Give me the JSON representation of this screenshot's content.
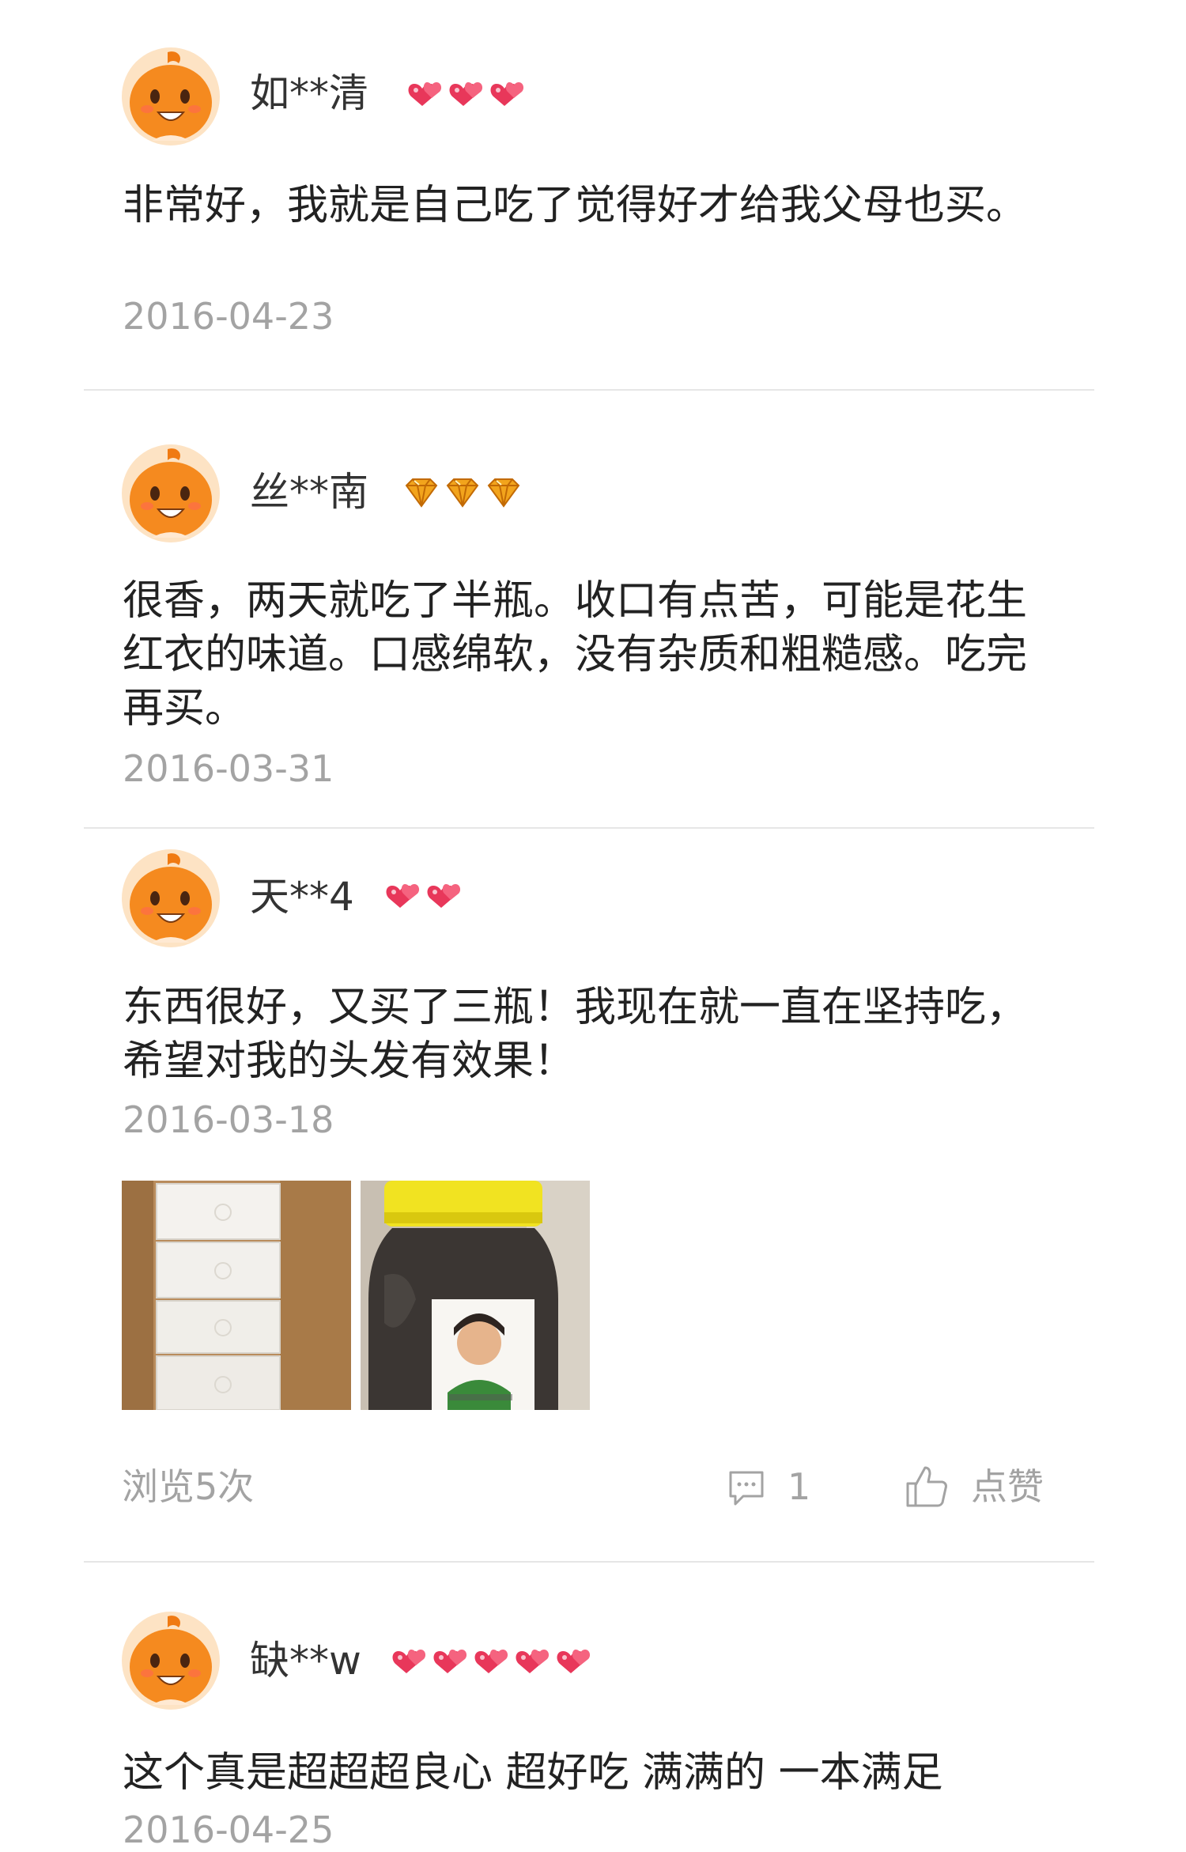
{
  "colors": {
    "text": "#222222",
    "muted": "#a3a3a3",
    "divider": "#e6e6e6",
    "avatar": "#f58a1f",
    "heart": "#e8375a",
    "diamond": "#f2a41c"
  },
  "reviews": [
    {
      "username": "如**清",
      "badge_icon": "heart-badge-icon",
      "badge_count": 3,
      "content": "非常好，我就是自己吃了觉得好才给我父母也买。",
      "date": "2016-04-23"
    },
    {
      "username": "丝**南",
      "badge_icon": "diamond-badge-icon",
      "badge_count": 3,
      "content": "很香，两天就吃了半瓶。收口有点苦，可能是花生红衣的味道。口感绵软，没有杂质和粗糙感。吃完再买。",
      "date": "2016-03-31"
    },
    {
      "username": "天**4",
      "badge_icon": "heart-badge-icon",
      "badge_count": 2,
      "content": "东西很好，又买了三瓶！我现在就一直在坚持吃，希望对我的头发有效果！",
      "date": "2016-03-18",
      "photos": [
        "box-photo",
        "jar-photo"
      ],
      "views_label": "浏览5次",
      "comment_count": "1",
      "like_label": "点赞"
    },
    {
      "username": "缺**w",
      "badge_icon": "heart-badge-icon",
      "badge_count": 5,
      "content": "这个真是超超超良心 超好吃 满满的  一本满足",
      "date": "2016-04-25"
    }
  ]
}
